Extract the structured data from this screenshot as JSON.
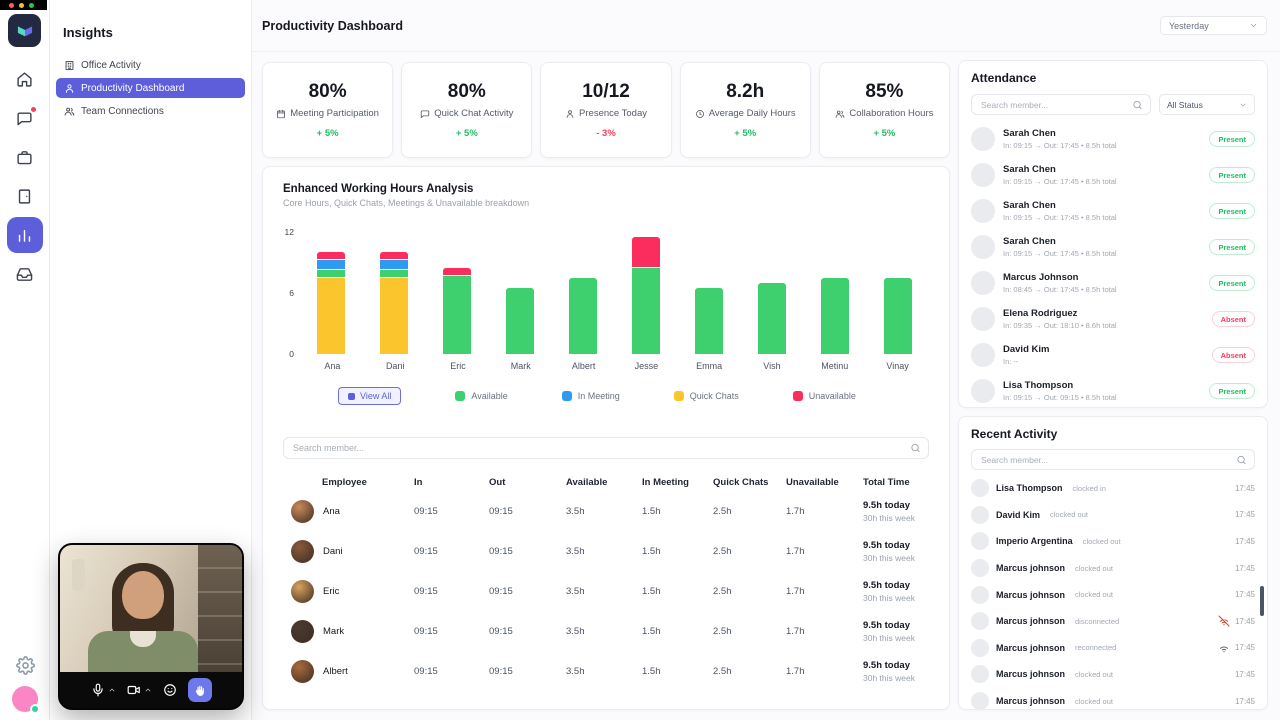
{
  "window": {
    "controls": [
      "close",
      "minimize",
      "maximize"
    ]
  },
  "rail": {
    "items": [
      {
        "icon": "home-icon"
      },
      {
        "icon": "chat-icon",
        "badge": true
      },
      {
        "icon": "briefcase-icon"
      },
      {
        "icon": "rooms-icon"
      },
      {
        "icon": "insights-icon",
        "active": true
      },
      {
        "icon": "inbox-icon"
      }
    ],
    "settings_icon": "gear-icon"
  },
  "sidebar": {
    "title": "Insights",
    "items": [
      {
        "label": "Office Activity",
        "icon": "building-icon",
        "active": false
      },
      {
        "label": "Productivity Dashboard",
        "icon": "person-icon",
        "active": true
      },
      {
        "label": "Team Connections",
        "icon": "people-icon",
        "active": false
      }
    ]
  },
  "header": {
    "title": "Productivity Dashboard",
    "period": "Yesterday"
  },
  "kpis": [
    {
      "value": "80%",
      "label": "Meeting Participation",
      "icon": "calendar-icon",
      "delta": "+ 5%",
      "trend": "up"
    },
    {
      "value": "80%",
      "label": "Quick Chat Activity",
      "icon": "chat-icon",
      "delta": "+ 5%",
      "trend": "up"
    },
    {
      "value": "10/12",
      "label": "Presence Today",
      "icon": "person-icon",
      "delta": "- 3%",
      "trend": "down"
    },
    {
      "value": "8.2h",
      "label": "Average Daily Hours",
      "icon": "clock-icon",
      "delta": "+ 5%",
      "trend": "up"
    },
    {
      "value": "85%",
      "label": "Collaboration Hours",
      "icon": "people-icon",
      "delta": "+ 5%",
      "trend": "up"
    }
  ],
  "chart_data": {
    "type": "stacked-bar",
    "title": "Enhanced Working Hours Analysis",
    "subtitle": "Core Hours, Quick Chats, Meetings & Unavailable breakdown",
    "categories": [
      "Ana",
      "Dani",
      "Eric",
      "Mark",
      "Albert",
      "Jesse",
      "Emma",
      "Vish",
      "Metinu",
      "Vinay"
    ],
    "series": [
      {
        "name": "Quick Chats",
        "color": "#fbc62d",
        "values": [
          7.5,
          7.5,
          0,
          0,
          0,
          0,
          0,
          0,
          0,
          0
        ]
      },
      {
        "name": "Available",
        "color": "#3ed06e",
        "values": [
          0.8,
          0.8,
          7.7,
          6.5,
          7.5,
          8.5,
          6.5,
          7,
          7.5,
          7.5
        ]
      },
      {
        "name": "In Meeting",
        "color": "#2e9bf0",
        "values": [
          0.9,
          0.9,
          0,
          0,
          0,
          0,
          0,
          0,
          0,
          0
        ]
      },
      {
        "name": "Unavailable",
        "color": "#fb2c5e",
        "values": [
          0.8,
          0.8,
          0.8,
          0,
          0,
          3,
          0,
          0,
          0,
          0
        ]
      }
    ],
    "ylim": [
      0,
      12
    ],
    "yticks": [
      0,
      6,
      12
    ],
    "grid": false,
    "legend_position": "bottom",
    "legend": [
      "Available",
      "In Meeting",
      "Quick Chats",
      "Unavailable"
    ],
    "view_all_label": "View All"
  },
  "table": {
    "search_placeholder": "Search member...",
    "columns": [
      "Employee",
      "In",
      "Out",
      "Available",
      "In Meeting",
      "Quick Chats",
      "Unavailable",
      "Total Time"
    ],
    "rows": [
      {
        "name": "Ana",
        "in": "09:15",
        "out": "09:15",
        "available": "3.5h",
        "in_meeting": "1.5h",
        "quick_chats": "2.5h",
        "unavailable": "1.7h",
        "total_today": "9.5h today",
        "total_week": "30h this week",
        "avatar_color": "#c98a5a"
      },
      {
        "name": "Dani",
        "in": "09:15",
        "out": "09:15",
        "available": "3.5h",
        "in_meeting": "1.5h",
        "quick_chats": "2.5h",
        "unavailable": "1.7h",
        "total_today": "9.5h today",
        "total_week": "30h this week",
        "avatar_color": "#8a5a3b"
      },
      {
        "name": "Eric",
        "in": "09:15",
        "out": "09:15",
        "available": "3.5h",
        "in_meeting": "1.5h",
        "quick_chats": "2.5h",
        "unavailable": "1.7h",
        "total_today": "9.5h today",
        "total_week": "30h this week",
        "avatar_color": "#d8a25e"
      },
      {
        "name": "Mark",
        "in": "09:15",
        "out": "09:15",
        "available": "3.5h",
        "in_meeting": "1.5h",
        "quick_chats": "2.5h",
        "unavailable": "1.7h",
        "total_today": "9.5h today",
        "total_week": "30h this week",
        "avatar_color": "#4a3a30"
      },
      {
        "name": "Albert",
        "in": "09:15",
        "out": "09:15",
        "available": "3.5h",
        "in_meeting": "1.5h",
        "quick_chats": "2.5h",
        "unavailable": "1.7h",
        "total_today": "9.5h today",
        "total_week": "30h this week",
        "avatar_color": "#a96a3e"
      }
    ]
  },
  "attendance": {
    "title": "Attendance",
    "search_placeholder": "Search member...",
    "status_filter": "All Status",
    "rows": [
      {
        "name": "Sarah Chen",
        "detail": "In: 09:15 → Out: 17:45  •  8.5h total",
        "status": "Present"
      },
      {
        "name": "Sarah Chen",
        "detail": "In: 09:15 → Out: 17:45  •  8.5h total",
        "status": "Present"
      },
      {
        "name": "Sarah Chen",
        "detail": "In: 09:15 → Out: 17:45  •  8.5h total",
        "status": "Present"
      },
      {
        "name": "Sarah Chen",
        "detail": "In: 09:15 → Out: 17:45  •  8.5h total",
        "status": "Present"
      },
      {
        "name": "Marcus Johnson",
        "detail": "In: 08:45 → Out: 17:45  •  8.5h total",
        "status": "Present"
      },
      {
        "name": "Elena Rodriguez",
        "detail": "In: 09:35 → Out: 18:10  •  8.6h total",
        "status": "Absent"
      },
      {
        "name": "David Kim",
        "detail": "In: --",
        "status": "Absent"
      },
      {
        "name": "Lisa Thompson",
        "detail": "In: 09:15 → Out: 09:15  •  8.5h total",
        "status": "Present"
      }
    ]
  },
  "recent_activity": {
    "title": "Recent Activity",
    "search_placeholder": "Search member...",
    "rows": [
      {
        "name": "Lisa Thompson",
        "action": "clocked in",
        "time": "17:45"
      },
      {
        "name": "David Kim",
        "action": "clocked out",
        "time": "17:45"
      },
      {
        "name": "Imperio Argentina",
        "action": "clocked out",
        "time": "17:45"
      },
      {
        "name": "Marcus johnson",
        "action": "clocked out",
        "time": "17:45"
      },
      {
        "name": "Marcus johnson",
        "action": "clocked out",
        "time": "17:45"
      },
      {
        "name": "Marcus johnson",
        "action": "disconnected",
        "time": "17:45",
        "icon": "wifi-off-icon"
      },
      {
        "name": "Marcus johnson",
        "action": "reconnected",
        "time": "17:45",
        "icon": "wifi-icon"
      },
      {
        "name": "Marcus johnson",
        "action": "clocked out",
        "time": "17:45"
      },
      {
        "name": "Marcus johnson",
        "action": "clocked out",
        "time": "17:45"
      }
    ]
  },
  "video": {
    "controls": [
      {
        "icon": "mic-icon",
        "expand": true
      },
      {
        "icon": "camera-icon",
        "expand": true
      },
      {
        "icon": "emoji-icon"
      },
      {
        "icon": "raise-hand-icon",
        "highlighted": true
      }
    ]
  },
  "colors": {
    "accent": "#5c5fd9",
    "positive": "#1fbf63",
    "negative": "#f63e5c"
  }
}
